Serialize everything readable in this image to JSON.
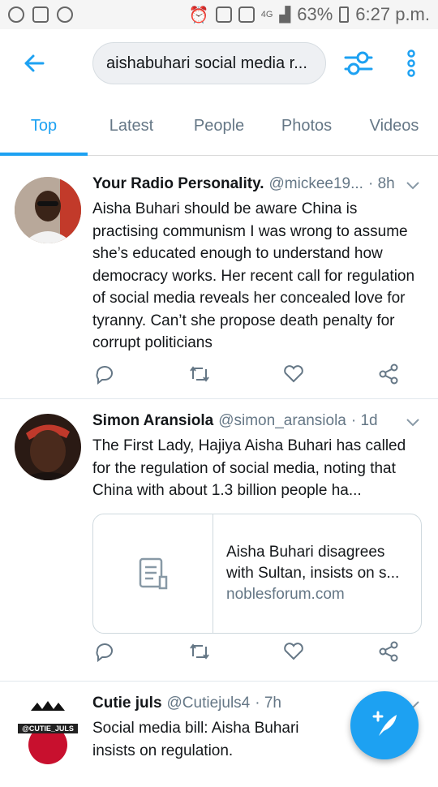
{
  "status_bar": {
    "battery": "63%",
    "time": "6:27 p.m.",
    "network": "4G"
  },
  "search": {
    "query": "aishabuhari social media  r..."
  },
  "tabs": [
    {
      "label": "Top",
      "active": true
    },
    {
      "label": "Latest",
      "active": false
    },
    {
      "label": "People",
      "active": false
    },
    {
      "label": "Photos",
      "active": false
    },
    {
      "label": "Videos",
      "active": false
    }
  ],
  "tweets": [
    {
      "name": "Your Radio Personality.",
      "handle": "@mickee19...",
      "time": "· 8h",
      "text": "Aisha Buhari should be aware China is practising communism I was wrong to assume she’s educated enough to understand how democracy works. Her recent call for regulation of social media reveals her concealed love for tyranny. Can’t she propose death penalty for corrupt politicians"
    },
    {
      "name": "Simon Aransiola",
      "handle": "@simon_aransiola",
      "time": "· 1d",
      "text": "The First Lady, Hajiya Aisha Buhari has called for the regulation of social media, noting that China with about 1.3 billion people ha...",
      "card": {
        "title": "Aisha Buhari disagrees with Sultan, insists on s...",
        "domain": "noblesforum.com"
      }
    },
    {
      "name": "Cutie juls",
      "handle": "@Cutiejuls4",
      "time": "· 7h",
      "text": "Social media bill: Aisha Buhari insists on regulation.",
      "avatar_text": "@CUTIE_JULS"
    }
  ],
  "colors": {
    "accent": "#1da1f2",
    "secondary_text": "#657786"
  }
}
